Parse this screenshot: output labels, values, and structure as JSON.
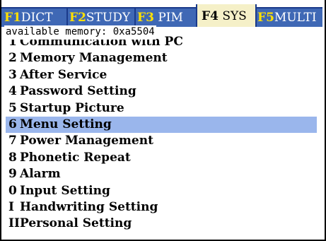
{
  "tabs": [
    {
      "key": "F1",
      "label": "DICT",
      "active": false
    },
    {
      "key": "F2",
      "label": "STUDY",
      "active": false
    },
    {
      "key": "F3",
      "label": "PIM",
      "active": false
    },
    {
      "key": "F4",
      "label": "SYS",
      "active": true
    },
    {
      "key": "F5",
      "label": "MULTI",
      "active": false
    }
  ],
  "memory_text": "available memory: 0xa5504",
  "menu": {
    "selected_index": 5,
    "items": [
      {
        "num": "1",
        "label": "Communication with PC"
      },
      {
        "num": "2",
        "label": "Memory Management"
      },
      {
        "num": "3",
        "label": "After Service"
      },
      {
        "num": "4",
        "label": "Password Setting"
      },
      {
        "num": "5",
        "label": "Startup Picture"
      },
      {
        "num": "6",
        "label": "Menu Setting"
      },
      {
        "num": "7",
        "label": "Power Management"
      },
      {
        "num": "8",
        "label": "Phonetic Repeat"
      },
      {
        "num": "9",
        "label": "Alarm"
      },
      {
        "num": "0",
        "label": "Input Setting"
      },
      {
        "num": "I",
        "label": "Handwriting Setting"
      },
      {
        "num": "II",
        "label": "Personal Setting"
      }
    ]
  },
  "colors": {
    "tab_bar": "#3f68b5",
    "tab_key": "#ffe000",
    "tab_active_bg": "#f5f0c8",
    "selection": "#9ab6ec"
  }
}
